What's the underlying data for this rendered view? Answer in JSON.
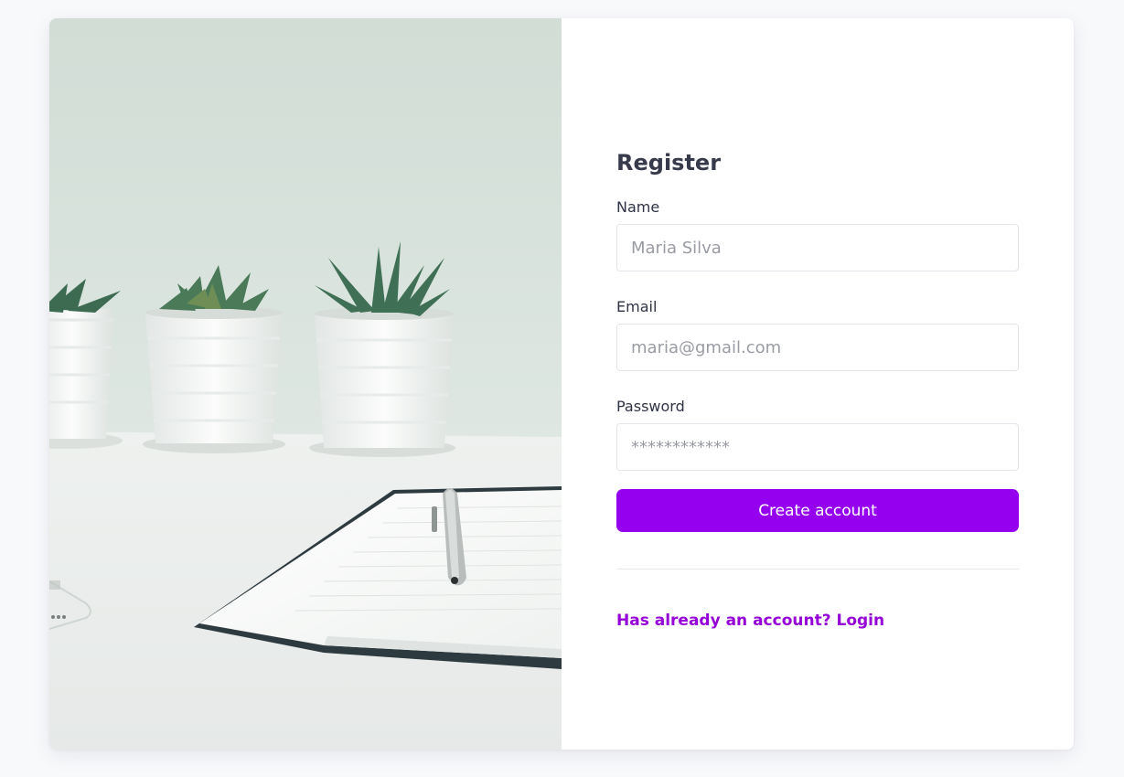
{
  "hero": {
    "image": "desk-with-succulent-pots-notebook-pen-phone"
  },
  "form": {
    "title": "Register",
    "name_label": "Name",
    "name_placeholder": "Maria Silva",
    "email_label": "Email",
    "email_placeholder": "maria@gmail.com",
    "password_label": "Password",
    "password_placeholder": "************",
    "submit_label": "Create account",
    "login_link": "Has already an account? Login"
  },
  "colors": {
    "accent": "#9500ef",
    "link": "#9500d6",
    "background": "#f8f9fb"
  }
}
